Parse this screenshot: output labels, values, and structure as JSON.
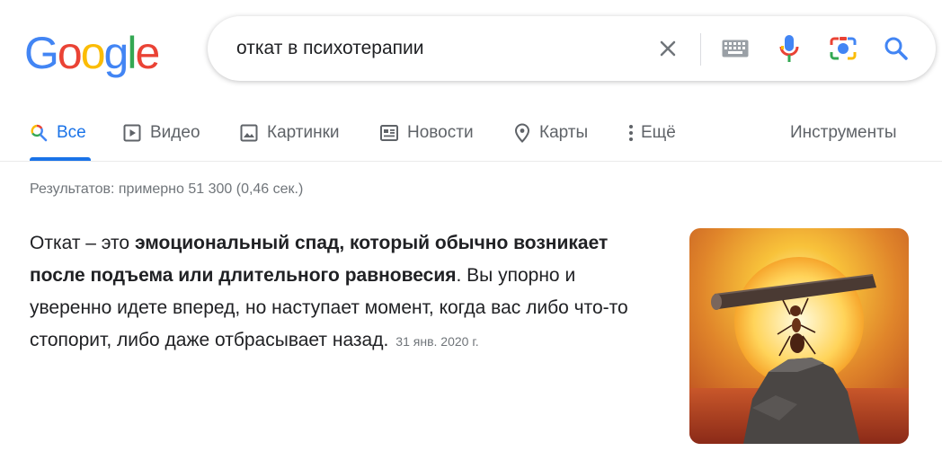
{
  "logo": {
    "text": "Google"
  },
  "search": {
    "query": "откат в психотерапии"
  },
  "tabs": [
    {
      "label": "Все",
      "icon": "search-icon"
    },
    {
      "label": "Видео",
      "icon": "video-icon"
    },
    {
      "label": "Картинки",
      "icon": "image-icon"
    },
    {
      "label": "Новости",
      "icon": "news-icon"
    },
    {
      "label": "Карты",
      "icon": "map-pin-icon"
    },
    {
      "label": "Ещё",
      "icon": "more-icon"
    }
  ],
  "tools_label": "Инструменты",
  "stats": "Результатов: примерно 51 300 (0,46 сек.)",
  "featured": {
    "text_start": "Откат – это ",
    "text_bold": "эмоциональный спад, который обычно возникает после подъема или длительного равновесия",
    "text_end": ". Вы упорно и уверенно идете вперед, но наступает момент, когда вас либо что-то стопорит, либо даже отбрасывает назад.",
    "date": "31 янв. 2020 г."
  },
  "colors": {
    "accent": "#1a73e8",
    "logo_blue": "#4285F4",
    "logo_red": "#EA4335",
    "logo_yellow": "#FBBC05",
    "logo_green": "#34A853"
  }
}
